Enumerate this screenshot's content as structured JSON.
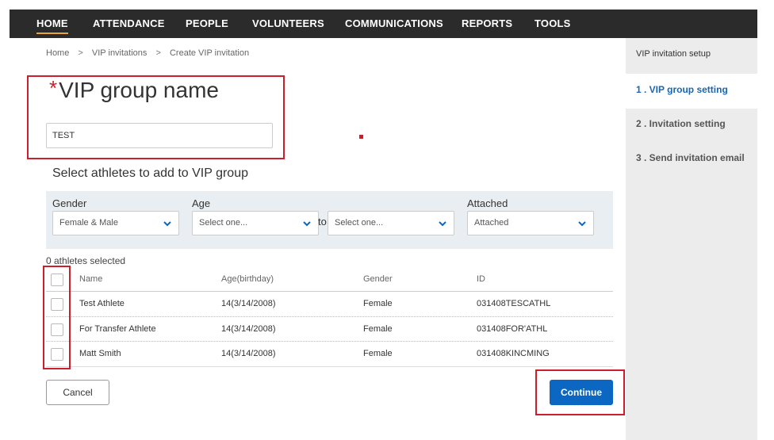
{
  "nav": {
    "items": [
      "HOME",
      "ATTENDANCE",
      "PEOPLE",
      "VOLUNTEERS",
      "COMMUNICATIONS",
      "REPORTS",
      "TOOLS"
    ],
    "active": "HOME"
  },
  "breadcrumb": {
    "items": [
      "Home",
      "VIP invitations",
      "Create VIP invitation"
    ],
    "separator": ">"
  },
  "form": {
    "required_mark": "*",
    "title": "VIP group name",
    "name_value": "TEST"
  },
  "athletes": {
    "section_title": "Select athletes to add to VIP group",
    "filters": {
      "gender_label": "Gender",
      "gender_value": "Female & Male",
      "age_label": "Age",
      "age_from": "Select one...",
      "age_to_label": "to",
      "age_to": "Select one...",
      "attached_label": "Attached",
      "attached_value": "Attached"
    },
    "selected_count": "0 athletes selected",
    "columns": [
      "Name",
      "Age(birthday)",
      "Gender",
      "ID"
    ],
    "rows": [
      [
        "Test Athlete",
        "14(3/14/2008)",
        "Female",
        "031408TESCATHL"
      ],
      [
        "For Transfer Athlete",
        "14(3/14/2008)",
        "Female",
        "031408FOR'ATHL"
      ],
      [
        "Matt Smith",
        "14(3/14/2008)",
        "Female",
        "031408KINCMING"
      ]
    ]
  },
  "actions": {
    "cancel_label": "Cancel",
    "continue_label": "Continue"
  },
  "sidebar": {
    "title": "VIP invitation setup",
    "steps": [
      "1 . VIP group setting",
      "2 . Invitation setting",
      "3 . Send invitation email"
    ],
    "active_step": 0
  },
  "colors": {
    "nav_bg": "#2b2b2b",
    "accent_blue": "#0b67c2",
    "highlight_red": "#cc1f2d",
    "filter_bg": "#e9eef2",
    "sidebar_bg": "#ececec"
  }
}
